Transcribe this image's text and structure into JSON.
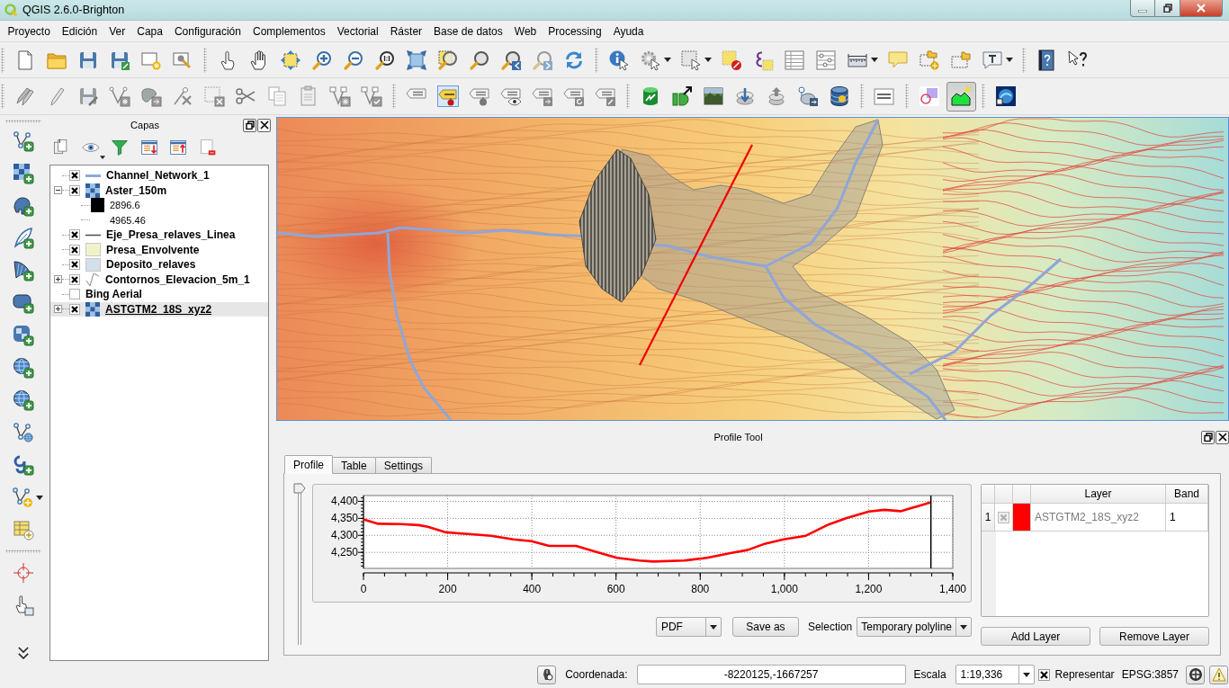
{
  "window": {
    "title": "QGIS 2.6.0-Brighton"
  },
  "menu": [
    "Proyecto",
    "Edición",
    "Ver",
    "Capa",
    "Configuración",
    "Complementos",
    "Vectorial",
    "Ráster",
    "Base de datos",
    "Web",
    "Processing",
    "Ayuda"
  ],
  "toolbars": {
    "profile_tool_on": true
  },
  "layers_panel": {
    "title": "Capas",
    "items": [
      {
        "name": "Channel_Network_1",
        "checked": true,
        "kind": "line",
        "color": "#8eaadb",
        "selected": false
      },
      {
        "name": "Aster_150m",
        "checked": true,
        "kind": "raster",
        "expanded": true,
        "selected": false,
        "legend": [
          {
            "label": "2896.6",
            "color": "#000000"
          },
          {
            "label": "4965.46"
          }
        ]
      },
      {
        "name": "Eje_Presa_relaves_Linea",
        "checked": true,
        "kind": "line",
        "color": "#555555",
        "selected": false
      },
      {
        "name": "Presa_Envolvente",
        "checked": true,
        "kind": "fill",
        "color": "#f1f2c8",
        "selected": false
      },
      {
        "name": "Deposito_relaves",
        "checked": true,
        "kind": "fill",
        "color": "#d3dfea",
        "selected": false
      },
      {
        "name": "Contornos_Elevacion_5m_1",
        "checked": true,
        "kind": "contour",
        "expanded": false,
        "selected": false
      },
      {
        "name": "Bing Aerial",
        "checked": false,
        "kind": "plain",
        "selected": false
      },
      {
        "name": "ASTGTM2_18S_xyz2",
        "checked": true,
        "kind": "raster",
        "expanded": false,
        "selected": true
      }
    ]
  },
  "profile_tool": {
    "title": "Profile Tool",
    "tabs": [
      {
        "label": "Profile",
        "selected": true
      },
      {
        "label": "Table",
        "selected": false
      },
      {
        "label": "Settings",
        "selected": false
      }
    ],
    "slider": {
      "level": 1
    },
    "chart_data": {
      "type": "line",
      "x": [
        0,
        35,
        89,
        131,
        153,
        196,
        249,
        303,
        356,
        399,
        441,
        505,
        548,
        602,
        655,
        688,
        762,
        816,
        869,
        912,
        955,
        998,
        1051,
        1105,
        1148,
        1201,
        1238,
        1276,
        1318,
        1348
      ],
      "series": [
        {
          "color": "#ff0000",
          "values": [
            4347,
            4334,
            4333,
            4330,
            4325,
            4309,
            4304,
            4299,
            4288,
            4283,
            4269,
            4269,
            4253,
            4234,
            4226,
            4223,
            4226,
            4234,
            4247,
            4257,
            4276,
            4288,
            4299,
            4332,
            4351,
            4370,
            4375,
            4371,
            4386,
            4397
          ]
        }
      ],
      "xlim": [
        0,
        1400
      ],
      "ylim": [
        4203,
        4417
      ],
      "xticks": [
        0,
        200,
        400,
        600,
        800,
        {
          "value": 1000,
          "label": "1,000"
        },
        {
          "value": 1200,
          "label": "1,200"
        },
        {
          "value": 1400,
          "label": "1,400"
        }
      ],
      "yticks": [
        {
          "value": 4250,
          "label": "4,250"
        },
        {
          "value": 4300,
          "label": "4,300"
        },
        {
          "value": 4350,
          "label": "4,350"
        },
        {
          "value": 4400,
          "label": "4,400"
        }
      ],
      "grid": true,
      "ref_lines": [
        {
          "axis": "x",
          "value": 1348,
          "color": "#000000"
        }
      ]
    },
    "format": "PDF",
    "save_button": "Save as",
    "selection_label": "Selection",
    "selection": "Temporary polyline",
    "layer_table": {
      "columns": [
        "Layer",
        "Band"
      ],
      "rows": [
        {
          "number": "1",
          "checked": true,
          "color": "#ff0000",
          "layer": "ASTGTM2_18S_xyz2",
          "band": "1"
        }
      ]
    },
    "add_button": "Add Layer",
    "remove_button": "Remove Layer"
  },
  "status_bar": {
    "coordinate_label": "Coordenada:",
    "coordinate": "-8220125,-1667257",
    "scale_label": "Escala",
    "scale": "1:19,336",
    "render": {
      "label": "Representar",
      "checked": true
    },
    "crs": "EPSG:3857"
  }
}
